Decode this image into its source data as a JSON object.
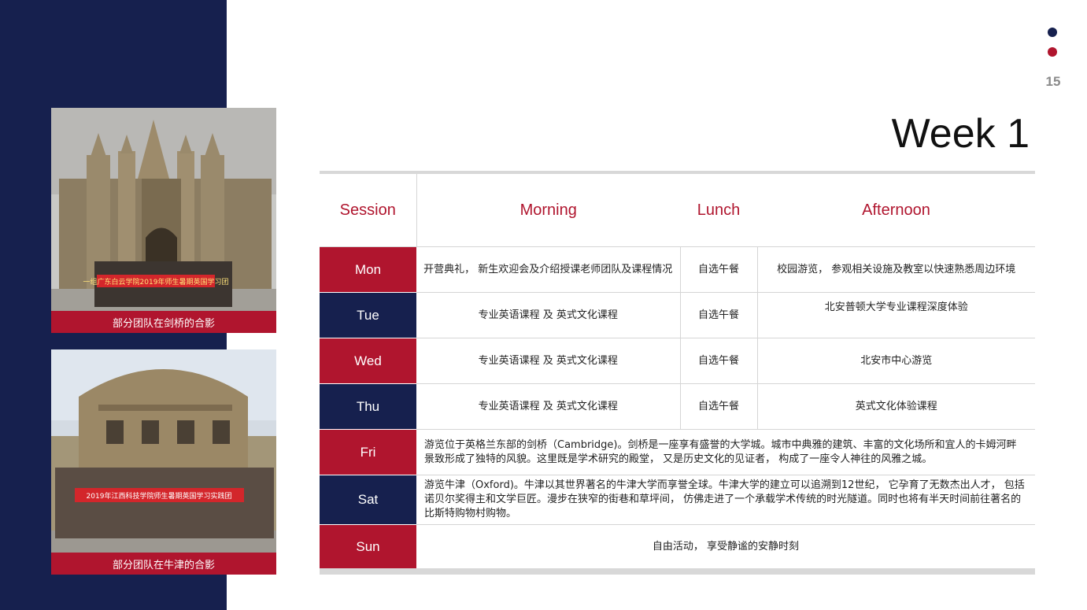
{
  "page_number": "15",
  "title": "Week 1",
  "colors": {
    "navy": "#16204e",
    "crimson": "#b0152e"
  },
  "photos": [
    {
      "caption": "部分团队在剑桥的合影",
      "banner_text": "一组广东白云学院2019年师生暑期英国学习团"
    },
    {
      "caption": "部分团队在牛津的合影",
      "banner_text": "2019年江西科技学院师生暑期英国学习实践团"
    }
  ],
  "table": {
    "headers": {
      "session": "Session",
      "morning": "Morning",
      "lunch": "Lunch",
      "afternoon": "Afternoon"
    },
    "rows": [
      {
        "day": "Mon",
        "morning": "开营典礼， 新生欢迎会及介绍授课老师团队及课程情况",
        "lunch": "自选午餐",
        "afternoon": "校园游览， 参观相关设施及教室以快速熟悉周边环境"
      },
      {
        "day": "Tue",
        "morning": "专业英语课程  及  英式文化课程",
        "lunch": "自选午餐",
        "afternoon": "北安普顿大学专业课程深度体验"
      },
      {
        "day": "Wed",
        "morning": "专业英语课程  及  英式文化课程",
        "lunch": "自选午餐",
        "afternoon": "北安市中心游览"
      },
      {
        "day": "Thu",
        "morning": "专业英语课程  及  英式文化课程",
        "lunch": "自选午餐",
        "afternoon": "英式文化体验课程"
      },
      {
        "day": "Fri",
        "full": "游览位于英格兰东部的剑桥（Cambridge)。剑桥是一座享有盛誉的大学城。城市中典雅的建筑、丰富的文化场所和宜人的卡姆河畔景致形成了独特的风貌。这里既是学术研究的殿堂， 又是历史文化的见证者， 构成了一座令人神往的风雅之城。"
      },
      {
        "day": "Sat",
        "full": "游览牛津（Oxford)。牛津以其世界著名的牛津大学而享誉全球。牛津大学的建立可以追溯到12世纪， 它孕育了无数杰出人才， 包括诺贝尔奖得主和文学巨匠。漫步在狭窄的街巷和草坪间， 仿佛走进了一个承载学术传统的时光隧道。同时也将有半天时间前往著名的比斯特购物村购物。"
      },
      {
        "day": "Sun",
        "full": "自由活动， 享受静谧的安静时刻"
      }
    ]
  }
}
